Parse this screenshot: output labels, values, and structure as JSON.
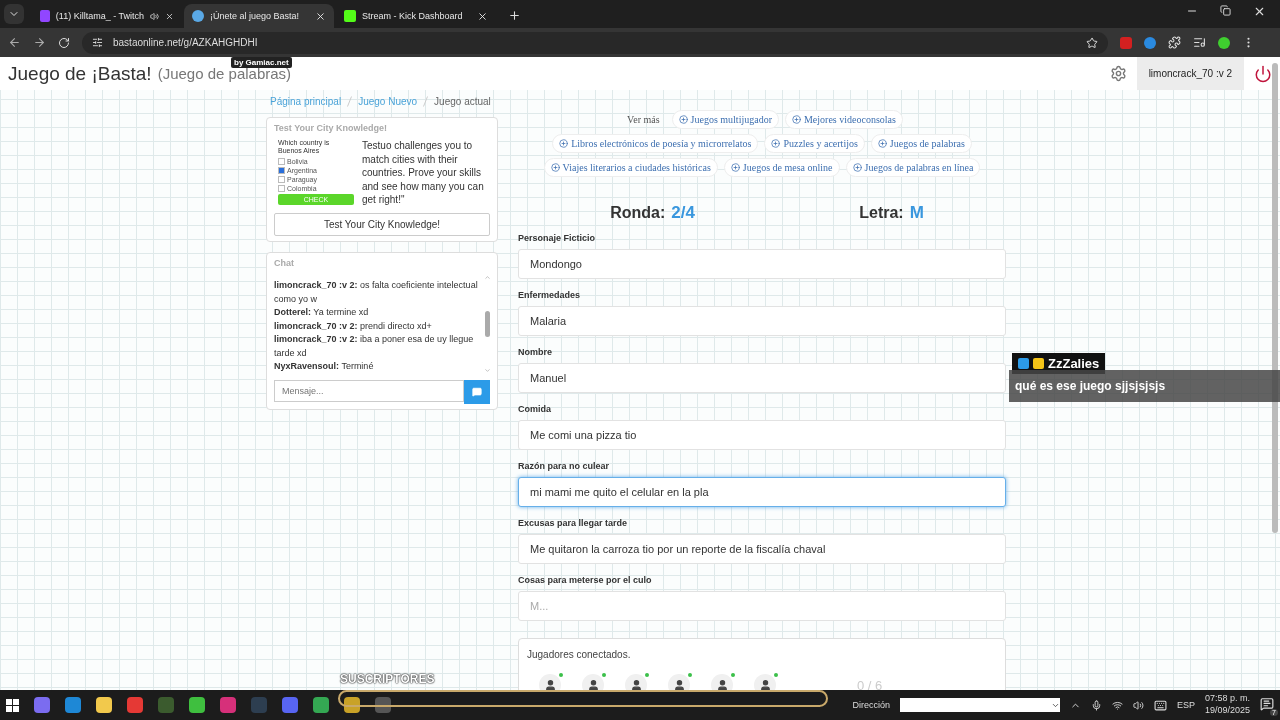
{
  "browser": {
    "tabs": [
      {
        "title": "(11) Killtama_ - Twitch",
        "selected": false,
        "kind": "twitch",
        "audio": true
      },
      {
        "title": "¡Únete al juego Basta!",
        "selected": true,
        "kind": "basta",
        "audio": false
      },
      {
        "title": "Stream - Kick Dashboard",
        "selected": false,
        "kind": "kick",
        "audio": false
      }
    ],
    "address": "bastaonline.net/g/AZKAHGHDHI"
  },
  "header": {
    "title": "Juego de ¡Basta!",
    "subtitle": "(Juego de palabras)",
    "badge": "by Gamiac.net",
    "user": "limoncrack_70 :v 2"
  },
  "breadcrumb": [
    {
      "label": "Página principal",
      "selected": false
    },
    {
      "label": "Juego Nuevo",
      "selected": false
    },
    {
      "label": "Juego actual",
      "selected": true
    }
  ],
  "ad": {
    "heading": "Test Your City Knowledge!",
    "quiz": {
      "question": "Which country is Buenos Aires",
      "options": [
        {
          "label": "Bolivia",
          "checked": false
        },
        {
          "label": "Argentina",
          "checked": true
        },
        {
          "label": "Paraguay",
          "checked": false
        },
        {
          "label": "Colombia",
          "checked": false
        }
      ],
      "button": "CHECK"
    },
    "description": "Testuo challenges you to match cities with their countries. Prove your skills and see how many you can get right!\"",
    "button": "Test Your City Knowledge!"
  },
  "chat": {
    "title": "Chat",
    "messages": [
      {
        "user": "limoncrack_70 :v 2:",
        "text": "os falta coeficiente intelectual como yo w"
      },
      {
        "user": "Dotterel:",
        "text": "Ya termine xd"
      },
      {
        "user": "limoncrack_70 :v 2:",
        "text": "prendi directo xd+"
      },
      {
        "user": "limoncrack_70 :v 2:",
        "text": "iba a poner esa de uy llegue tarde xd"
      },
      {
        "user": "NyxRavensoul:",
        "text": "Terminé"
      }
    ],
    "placeholder": "Mensaje..."
  },
  "links": {
    "label": "Ver más",
    "items": [
      "Juegos multijugador",
      "Mejores videoconsolas",
      "Libros electrónicos de poesía y microrrelatos",
      "Puzzles y acertijos",
      "Juegos de palabras",
      "Viajes literarios a ciudades históricas",
      "Juegos de mesa online",
      "Juegos de palabras en línea"
    ]
  },
  "round": {
    "label": "Ronda:",
    "value": "2/4"
  },
  "letter": {
    "label": "Letra:",
    "value": "M"
  },
  "fields": [
    {
      "label": "Personaje Ficticio",
      "value": "Mondongo",
      "focused": false
    },
    {
      "label": "Enfermedades",
      "value": "Malaria",
      "focused": false
    },
    {
      "label": "Nombre",
      "value": "Manuel",
      "focused": false
    },
    {
      "label": "Comida",
      "value": "Me comi una pizza tio",
      "focused": false
    },
    {
      "label": "Razón para no culear",
      "value": "mi mami me quito el celular en la pla",
      "focused": true
    },
    {
      "label": "Excusas para llegar tarde",
      "value": "Me quitaron la carroza tio por un reporte de la fiscalía chaval",
      "focused": false
    },
    {
      "label": "Cosas para meterse por el culo",
      "placeholder": "M...",
      "focused": false
    }
  ],
  "players": {
    "title": "Jugadores conectados.",
    "list": [
      {
        "online": true
      },
      {
        "online": true
      },
      {
        "online": true
      },
      {
        "online": true
      },
      {
        "online": true
      },
      {
        "online": true
      }
    ],
    "count": "0 / 6"
  },
  "overlay": {
    "user": "ZzZalies",
    "message": "qué es ese juego sjjsjsjsjs",
    "goal": "SUSCRIPTORES"
  },
  "taskbar": {
    "apps": [
      {
        "color": "#7b6cf0"
      },
      {
        "color": "#1e88d6"
      },
      {
        "color": "#f2c94c"
      },
      {
        "color": "#e53935"
      },
      {
        "color": "#3b5b2e"
      },
      {
        "color": "#3fbf3f"
      },
      {
        "color": "#d6307a"
      },
      {
        "color": "#2d3e50"
      },
      {
        "color": "#5865f2"
      },
      {
        "color": "#34a853"
      },
      {
        "color": "#c9a227"
      },
      {
        "color": "#555555"
      }
    ],
    "address_label": "Dirección",
    "language": "ESP",
    "time": "07:58 p. m.",
    "date": "19/09/2025",
    "notifications": "7"
  }
}
